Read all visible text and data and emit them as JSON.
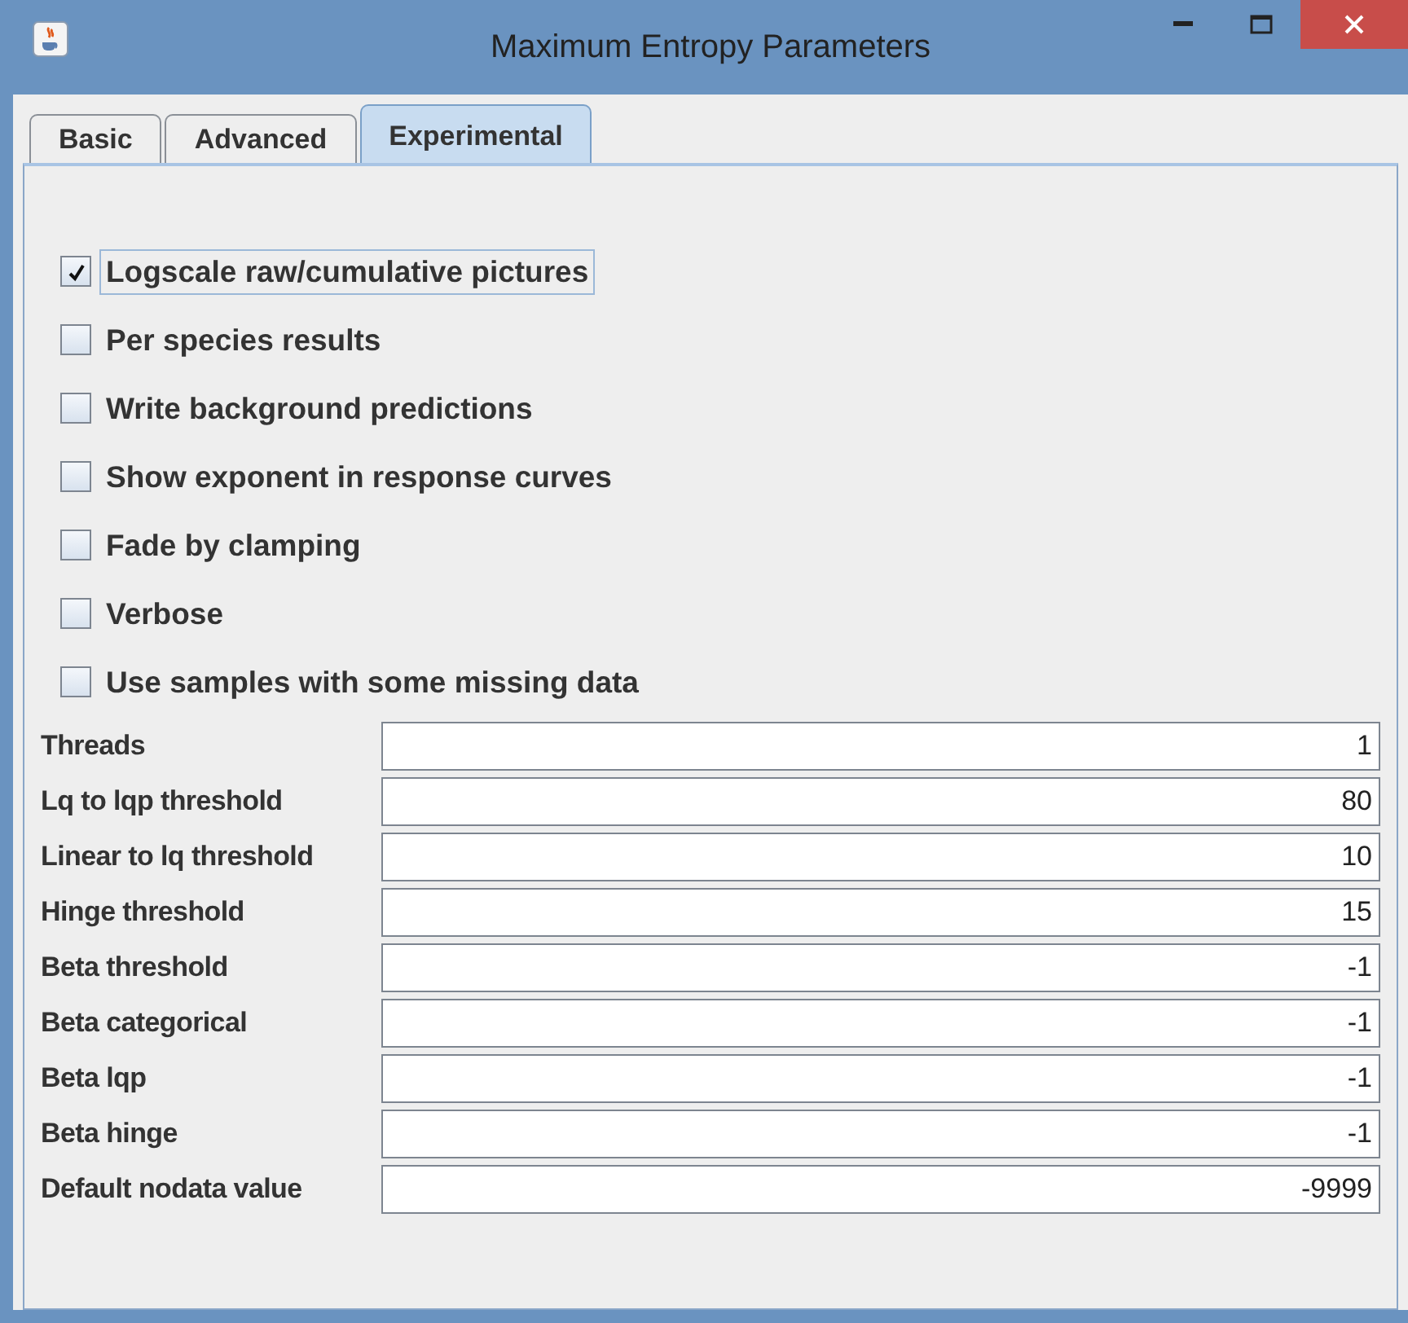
{
  "window": {
    "title": "Maximum Entropy Parameters"
  },
  "tabs": [
    {
      "label": "Basic",
      "selected": false
    },
    {
      "label": "Advanced",
      "selected": false
    },
    {
      "label": "Experimental",
      "selected": true
    }
  ],
  "options": [
    {
      "label": "Logscale raw/cumulative pictures",
      "checked": true,
      "focused": true
    },
    {
      "label": "Per species results",
      "checked": false,
      "focused": false
    },
    {
      "label": "Write background predictions",
      "checked": false,
      "focused": false
    },
    {
      "label": "Show exponent in response curves",
      "checked": false,
      "focused": false
    },
    {
      "label": "Fade by clamping",
      "checked": false,
      "focused": false
    },
    {
      "label": "Verbose",
      "checked": false,
      "focused": false
    },
    {
      "label": "Use samples with some missing data",
      "checked": false,
      "focused": false
    }
  ],
  "fields": [
    {
      "label": "Threads",
      "value": "1"
    },
    {
      "label": "Lq to lqp threshold",
      "value": "80"
    },
    {
      "label": "Linear to lq threshold",
      "value": "10"
    },
    {
      "label": "Hinge threshold",
      "value": "15"
    },
    {
      "label": "Beta threshold",
      "value": "-1"
    },
    {
      "label": "Beta categorical",
      "value": "-1"
    },
    {
      "label": "Beta lqp",
      "value": "-1"
    },
    {
      "label": "Beta hinge",
      "value": "-1"
    },
    {
      "label": "Default nodata value",
      "value": "-9999"
    }
  ]
}
